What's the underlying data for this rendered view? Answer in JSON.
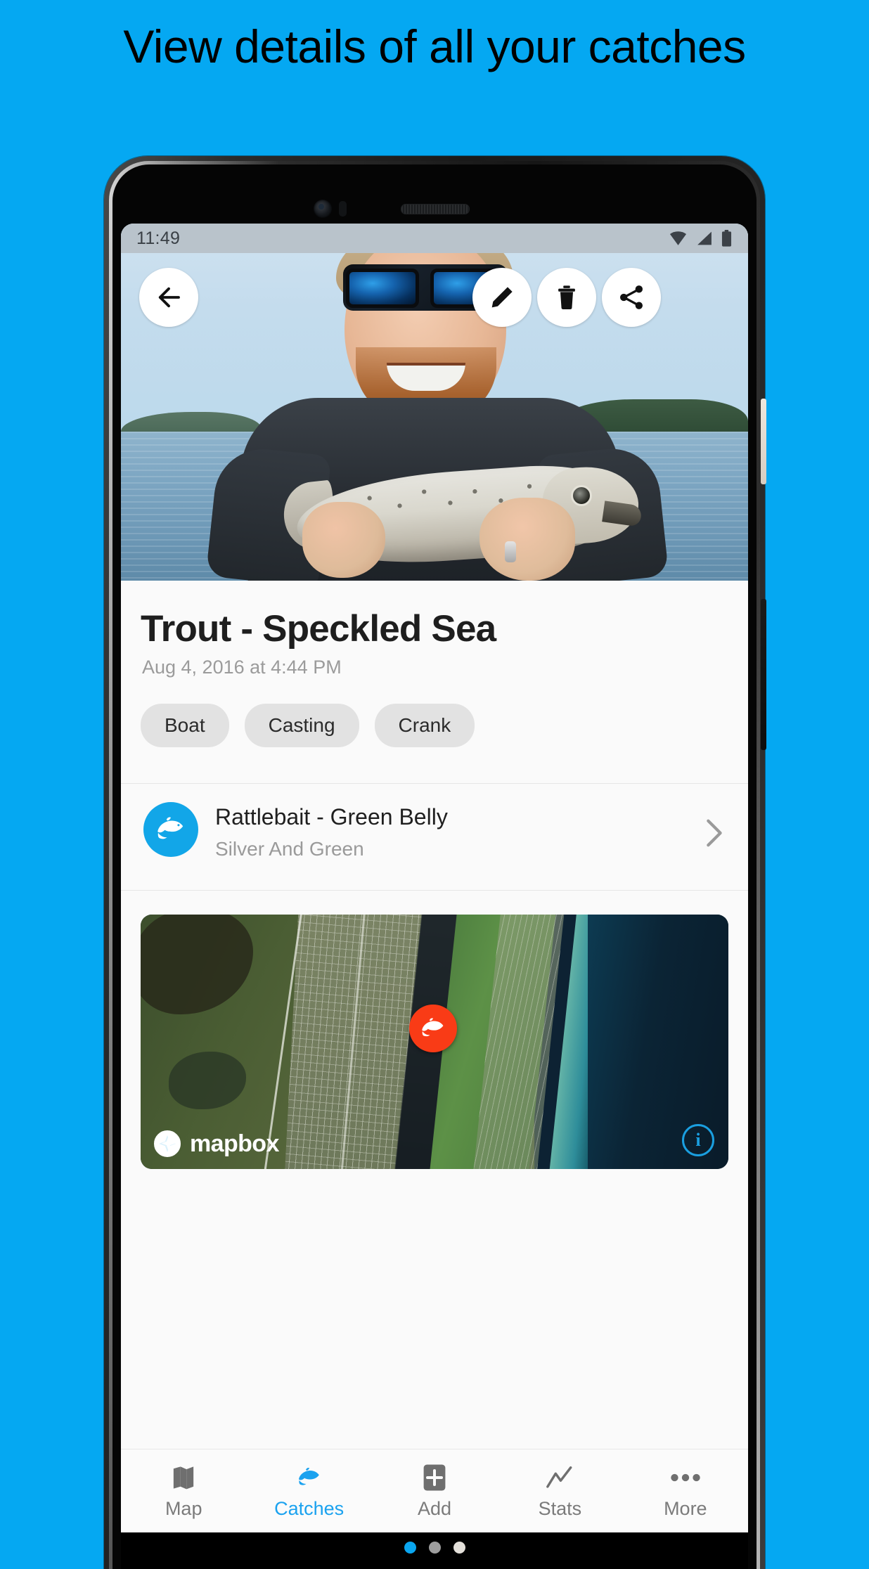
{
  "promo": {
    "headline": "View details of all your catches",
    "background_color": "#05a8f2"
  },
  "status_bar": {
    "time": "11:49",
    "icons": [
      "wifi-icon",
      "cellular-signal-icon",
      "battery-icon"
    ]
  },
  "hero": {
    "actions": [
      {
        "name": "back-button",
        "icon": "arrow-left-icon"
      },
      {
        "name": "edit-button",
        "icon": "pencil-icon"
      },
      {
        "name": "delete-button",
        "icon": "trash-icon"
      },
      {
        "name": "share-button",
        "icon": "share-icon"
      }
    ],
    "photo_count": 3,
    "active_photo_index": 0,
    "active_dot_color": "#0aa6f0",
    "inactive_dot_color": "#9e9e9e"
  },
  "detail": {
    "title": "Trout - Speckled Sea",
    "date": "Aug 4, 2016 at 4:44 PM",
    "chips": [
      "Boat",
      "Casting",
      "Crank"
    ],
    "bait": {
      "name": "Rattlebait - Green Belly",
      "color": "Silver And Green",
      "avatar_icon": "fish-icon",
      "avatar_color": "#12a6e8",
      "chevron_icon": "chevron-right-icon"
    },
    "map": {
      "marker_icon": "fish-marker-icon",
      "marker_color": "#f93b16",
      "attribution": "mapbox",
      "info_label": "i",
      "info_color": "#1a9fe0"
    }
  },
  "bottom_nav": {
    "active_color": "#1ba2ef",
    "items": [
      {
        "label": "Map",
        "icon": "map-icon",
        "active": false
      },
      {
        "label": "Catches",
        "icon": "fish-icon",
        "active": true
      },
      {
        "label": "Add",
        "icon": "plus-square-icon",
        "active": false
      },
      {
        "label": "Stats",
        "icon": "line-chart-icon",
        "active": false
      },
      {
        "label": "More",
        "icon": "ellipsis-icon",
        "active": false
      }
    ]
  }
}
